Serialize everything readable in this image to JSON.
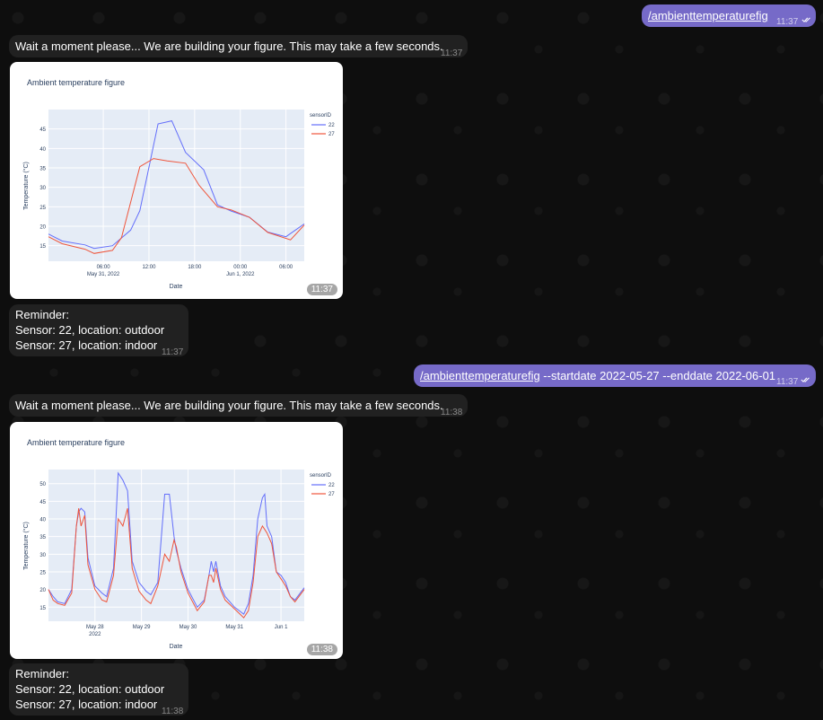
{
  "messages": {
    "m1": {
      "command": "/ambienttemperaturefig",
      "args": "",
      "time": "11:37"
    },
    "m2": {
      "text": "Wait a moment please... We are building your figure. This may take a few seconds.",
      "time": "11:37"
    },
    "m3": {
      "time": "11:37"
    },
    "m4": {
      "lines": [
        "Reminder:",
        "Sensor: 22, location: outdoor",
        "Sensor: 27, location: indoor"
      ],
      "time": "11:37"
    },
    "m5": {
      "command": "/ambienttemperaturefig",
      "args": " --startdate 2022-05-27 --enddate 2022-06-01",
      "time": "11:37"
    },
    "m6": {
      "text": "Wait a moment please... We are building your figure. This may take a few seconds.",
      "time": "11:38"
    },
    "m7": {
      "time": "11:38"
    },
    "m8": {
      "lines": [
        "Reminder:",
        "Sensor: 22, location: outdoor",
        "Sensor: 27, location: indoor"
      ],
      "time": "11:38"
    }
  },
  "colors": {
    "series_22": "#636efa",
    "series_27": "#ef553b",
    "plot_bg": "#e5ecf6"
  },
  "chart_data": [
    {
      "type": "line",
      "title": "Ambient temperature figure",
      "xlabel": "Date",
      "ylabel": "Temperature (°C)",
      "legend_title": "sensorID",
      "legend_position": "top-right",
      "ylim": [
        11,
        50
      ],
      "xlim": [
        0,
        28
      ],
      "yticks": [
        15,
        20,
        25,
        30,
        35,
        40,
        45
      ],
      "xticks": [
        {
          "at": 6,
          "label": "06:00",
          "sub": "May 31, 2022"
        },
        {
          "at": 11,
          "label": "12:00",
          "sub": ""
        },
        {
          "at": 16,
          "label": "18:00",
          "sub": ""
        },
        {
          "at": 21,
          "label": "00:00",
          "sub": "Jun 1, 2022"
        },
        {
          "at": 26,
          "label": "06:00",
          "sub": ""
        }
      ],
      "series": [
        {
          "name": "22",
          "x": [
            0,
            1.5,
            4,
            5,
            7,
            9,
            10,
            12,
            13.5,
            15,
            17,
            18.5,
            20,
            22,
            24,
            26,
            28
          ],
          "y": [
            18,
            16.2,
            15.2,
            14.3,
            15,
            19,
            24,
            46.3,
            47.1,
            39,
            34.5,
            25.5,
            23.9,
            22.3,
            18.5,
            17.3,
            20.6
          ]
        },
        {
          "name": "27",
          "x": [
            0,
            1.5,
            4,
            5,
            7,
            8,
            10,
            11.5,
            13,
            15,
            16.5,
            18.5,
            20,
            22,
            24,
            26.5,
            28
          ],
          "y": [
            17.3,
            15.5,
            14.1,
            13,
            13.8,
            17.1,
            35.3,
            37.4,
            36.8,
            36.2,
            30.5,
            25,
            24.2,
            22.3,
            18.4,
            16.5,
            20.3
          ]
        }
      ]
    },
    {
      "type": "line",
      "title": "Ambient temperature figure",
      "xlabel": "Date",
      "ylabel": "Temperature (°C)",
      "legend_title": "sensorID",
      "legend_position": "top-right",
      "ylim": [
        11,
        54
      ],
      "xlim": [
        0,
        5.5
      ],
      "yticks": [
        15,
        20,
        25,
        30,
        35,
        40,
        45,
        50
      ],
      "xticks": [
        {
          "at": 1,
          "label": "May 28",
          "sub": "2022"
        },
        {
          "at": 2,
          "label": "May 29",
          "sub": ""
        },
        {
          "at": 3,
          "label": "May 30",
          "sub": ""
        },
        {
          "at": 4,
          "label": "May 31",
          "sub": ""
        },
        {
          "at": 5,
          "label": "Jun 1",
          "sub": ""
        }
      ],
      "series": [
        {
          "name": "22",
          "x": [
            0,
            0.1,
            0.2,
            0.35,
            0.5,
            0.6,
            0.65,
            0.7,
            0.78,
            0.85,
            1,
            1.15,
            1.25,
            1.4,
            1.5,
            1.6,
            1.7,
            1.8,
            1.95,
            2.1,
            2.2,
            2.35,
            2.5,
            2.6,
            2.7,
            2.75,
            2.85,
            3,
            3.2,
            3.35,
            3.45,
            3.5,
            3.55,
            3.6,
            3.7,
            3.8,
            4,
            4.2,
            4.3,
            4.4,
            4.5,
            4.6,
            4.65,
            4.7,
            4.8,
            4.9,
            5,
            5.1,
            5.2,
            5.3,
            5.5
          ],
          "y": [
            20,
            18,
            16.5,
            16,
            20,
            38,
            42,
            43,
            42,
            29,
            21,
            19,
            18,
            26,
            53,
            51,
            48,
            28,
            22,
            19.5,
            18.5,
            22,
            47,
            47,
            35,
            31,
            26,
            20,
            15,
            17,
            24,
            28,
            25,
            28,
            21,
            18,
            15,
            13,
            16,
            24,
            40,
            46,
            47,
            38,
            35,
            25,
            24,
            22,
            18,
            17,
            20.5
          ]
        },
        {
          "name": "27",
          "x": [
            0,
            0.1,
            0.2,
            0.35,
            0.5,
            0.6,
            0.65,
            0.7,
            0.78,
            0.85,
            1,
            1.15,
            1.25,
            1.4,
            1.5,
            1.6,
            1.7,
            1.8,
            1.95,
            2.1,
            2.2,
            2.35,
            2.5,
            2.6,
            2.7,
            2.75,
            2.85,
            3,
            3.2,
            3.35,
            3.45,
            3.5,
            3.55,
            3.6,
            3.7,
            3.8,
            4,
            4.2,
            4.3,
            4.4,
            4.5,
            4.6,
            4.65,
            4.7,
            4.8,
            4.9,
            5,
            5.1,
            5.2,
            5.3,
            5.5
          ],
          "y": [
            20,
            17,
            16,
            15.5,
            19,
            38,
            43,
            38,
            41,
            27,
            20,
            17,
            16.5,
            24,
            40,
            38,
            43,
            26,
            19.5,
            17,
            16,
            21,
            30,
            28,
            34,
            32,
            25,
            19,
            14,
            16.5,
            24,
            24,
            22,
            26,
            20,
            17,
            14.5,
            12,
            14,
            22,
            35,
            38,
            37,
            36,
            33,
            25,
            23,
            21,
            18,
            16.5,
            20
          ]
        }
      ]
    }
  ]
}
